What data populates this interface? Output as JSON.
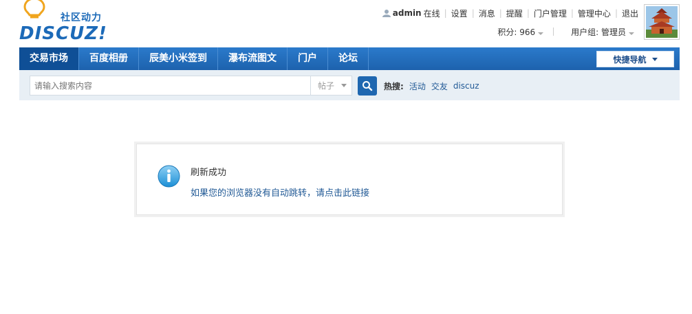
{
  "logo": {
    "wordmark": "DISCUZ!",
    "slogan": "社区动力"
  },
  "usernav": {
    "username": "admin",
    "items": [
      "在线",
      "设置",
      "消息",
      "提醒",
      "门户管理",
      "管理中心",
      "退出"
    ]
  },
  "userinfo": {
    "credits": "积分: 966",
    "group": "用户组: 管理员"
  },
  "nav": {
    "items": [
      "交易市场",
      "百度相册",
      "辰美小米签到",
      "瀑布流图文",
      "门户",
      "论坛"
    ],
    "active_index": 0,
    "quick_nav": "快捷导航"
  },
  "search": {
    "placeholder": "请输入搜索内容",
    "type": "帖子",
    "hot_label": "热搜:",
    "hot_terms": [
      "活动",
      "交友",
      "discuz"
    ]
  },
  "message": {
    "title": "刷新成功",
    "link": "如果您的浏览器没有自动跳转，请点击此链接"
  },
  "colors": {
    "brand_blue": "#1c6ab8",
    "nav_active": "#0f4f96",
    "link": "#225a96"
  }
}
